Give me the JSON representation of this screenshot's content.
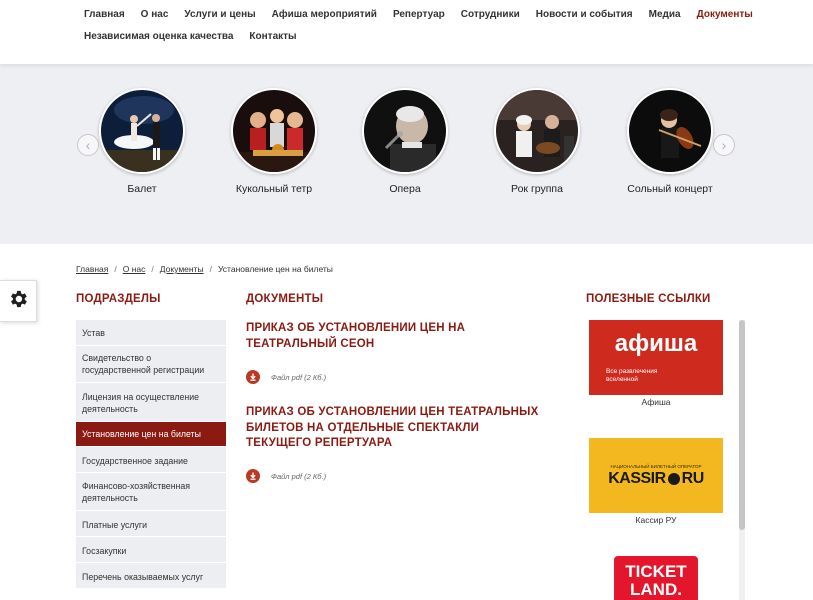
{
  "nav": {
    "row1": [
      "Главная",
      "О нас",
      "Услуги и цены",
      "Афиша мероприятий",
      "Репертуар",
      "Сотрудники",
      "Новости и события",
      "Медиа",
      "Документы"
    ],
    "row2": [
      "Независимая оценка качества",
      "Контакты"
    ],
    "active": "Документы"
  },
  "carousel": {
    "prev_arrow": "‹",
    "next_arrow": "›",
    "items": [
      {
        "label": "Балет",
        "icon": "ballet-photo"
      },
      {
        "label": "Кукольный тетр",
        "icon": "puppet-photo"
      },
      {
        "label": "Опера",
        "icon": "opera-photo"
      },
      {
        "label": "Рок группа",
        "icon": "rock-band-photo"
      },
      {
        "label": "Сольный концерт",
        "icon": "solo-concert-photo"
      }
    ]
  },
  "breadcrumb": {
    "items": [
      "Главная",
      "О нас",
      "Документы",
      "Установление цен на билеты"
    ],
    "separator": "/"
  },
  "sidebar": {
    "title": "ПОДРАЗДЕЛЫ",
    "items": [
      "Устав",
      "Свидетельство о государственной регистрации",
      "Лицензия на осуществление деятельность",
      "Установление цен на билеты",
      "Государственное задание",
      "Финансово-хозяйственная деятельность",
      "Платные услуги",
      "Госзакупки",
      "Перечень оказываемых услуг"
    ],
    "active_index": 3
  },
  "documents": {
    "title": "ДОКУМЕНТЫ",
    "items": [
      {
        "title": "ПРИКАЗ ОБ УСТАНОВЛЕНИИ ЦЕН НА ТЕАТРАЛЬНЫЙ СЕОН",
        "file": "Файл pdf (2 Кб.)"
      },
      {
        "title": "ПРИКАЗ ОБ УСТАНОВЛЕНИИ ЦЕН ТЕАТРАЛЬНЫХ БИЛЕТОВ НА ОТДЕЛЬНЫЕ СПЕКТАКЛИ ТЕКУЩЕГО РЕПЕРТУАРА",
        "file": "Файл pdf (2 Кб.)"
      }
    ]
  },
  "useful": {
    "title": "ПОЛЕЗНЫЕ ССЫЛКИ",
    "afisha": {
      "logo": "афиша",
      "tagline": "Все развлечения вселенной",
      "caption": "Афиша"
    },
    "kassir": {
      "small": "НАЦИОНАЛЬНЫЙ БИЛЕТНЫЙ ОПЕРАТОР",
      "logo_left": "KASSIR",
      "logo_right": "RU",
      "caption": "Кассир РУ"
    },
    "ticketland": {
      "line1": "TICKET",
      "line2": "LAND."
    }
  },
  "colors": {
    "accent": "#8b1a12",
    "afisha_red": "#cf2a1e",
    "kassir_yellow": "#f3b820",
    "ticketland_red": "#e3162b"
  }
}
